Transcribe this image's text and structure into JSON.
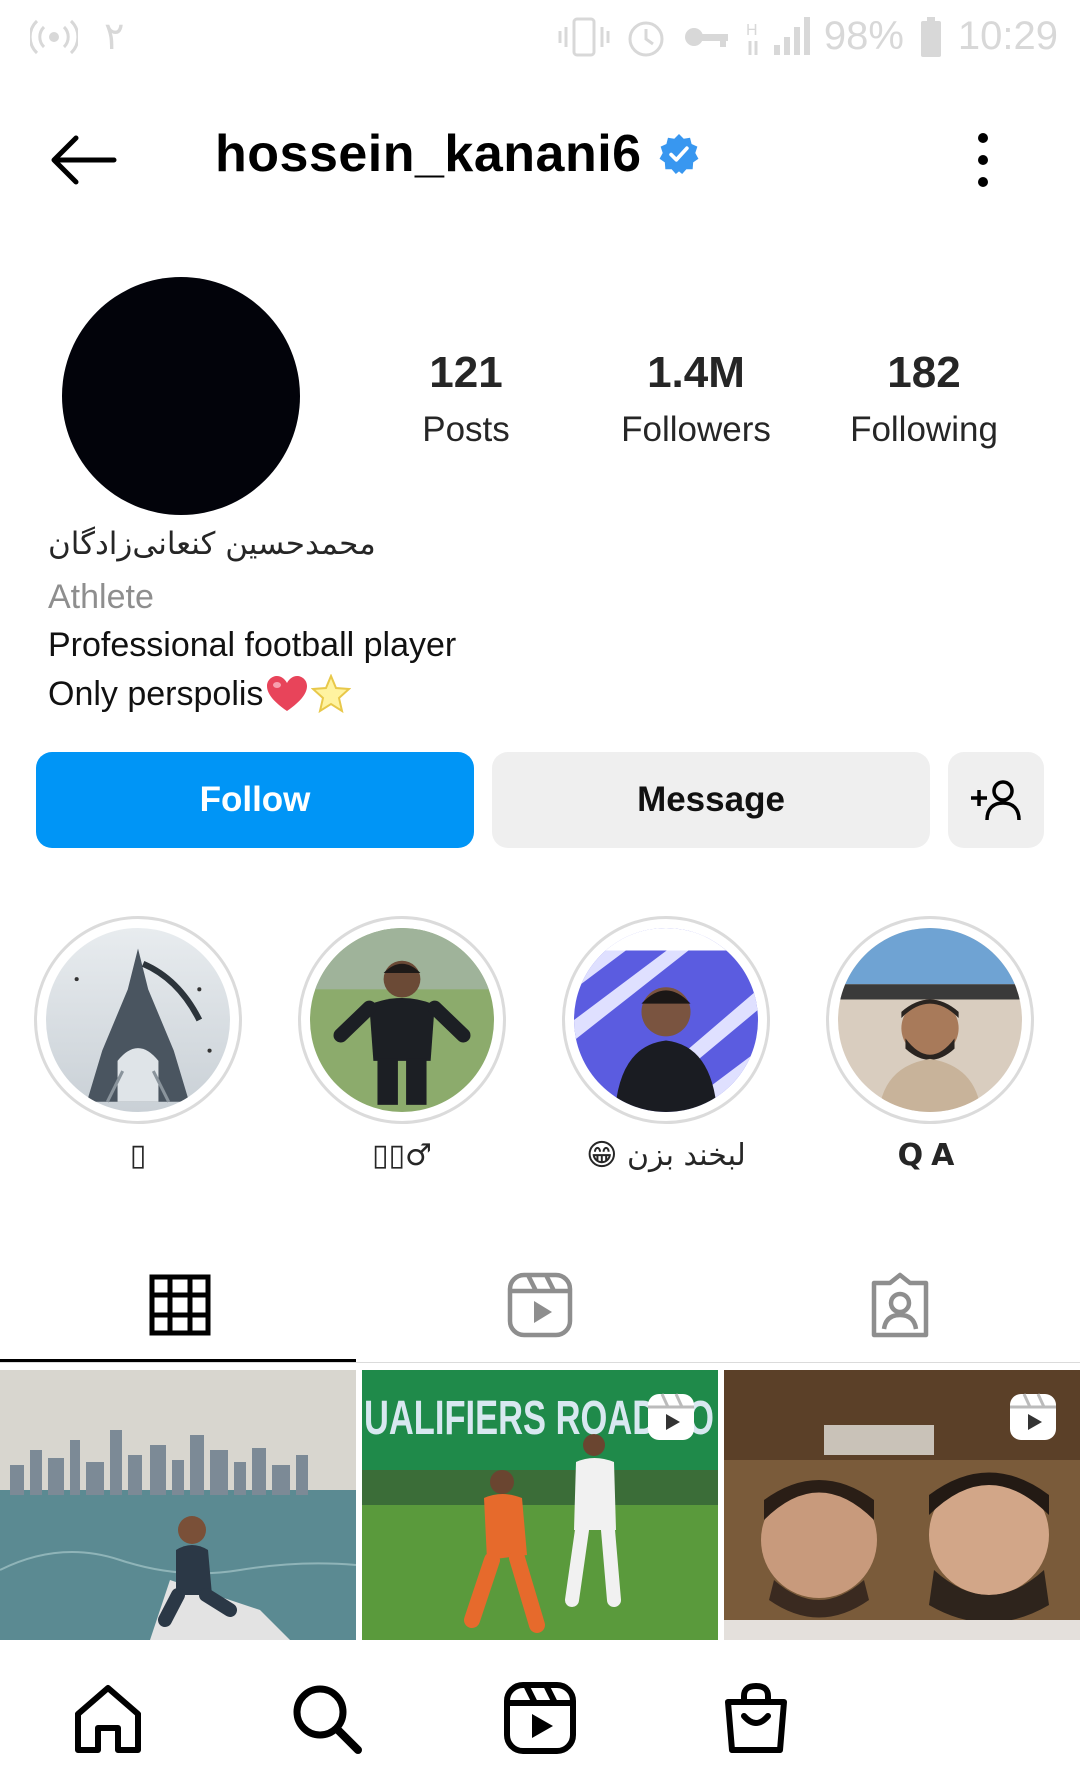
{
  "status_bar": {
    "sim_label": "۲",
    "battery": "98%",
    "time": "10:29"
  },
  "header": {
    "username": "hossein_kanani6",
    "icons": {
      "back": "arrow-left-icon",
      "verified": "verified-badge-icon",
      "menu": "more-vertical-icon"
    }
  },
  "profile": {
    "stats": [
      {
        "value": "121",
        "label": "Posts"
      },
      {
        "value": "1.4M",
        "label": "Followers"
      },
      {
        "value": "182",
        "label": "Following"
      }
    ],
    "full_name": "محمدحسین کنعانی‌زادگان",
    "category": "Athlete",
    "bio_line1": "Professional football player",
    "bio_line2": "Only perspolis"
  },
  "actions": {
    "follow_label": "Follow",
    "message_label": "Message",
    "add_user_icon": "add-user-icon"
  },
  "highlights": [
    {
      "caption": "▯"
    },
    {
      "caption": "▯▯♂"
    },
    {
      "caption": "لبخند بزن 😁"
    },
    {
      "caption": "QA"
    }
  ],
  "tabs": [
    {
      "name": "posts",
      "icon": "grid-icon"
    },
    {
      "name": "reels",
      "icon": "reels-icon"
    },
    {
      "name": "tagged",
      "icon": "tagged-icon"
    }
  ],
  "posts": [
    {
      "type": "photo"
    },
    {
      "type": "reel",
      "overlay_text": "UALIFIERS ROAD TO"
    },
    {
      "type": "reel"
    }
  ],
  "bottom_nav": [
    {
      "name": "home",
      "icon": "home-icon"
    },
    {
      "name": "search",
      "icon": "search-icon"
    },
    {
      "name": "reels",
      "icon": "reels-icon"
    },
    {
      "name": "shop",
      "icon": "shop-bag-icon"
    }
  ],
  "colors": {
    "follow_blue": "#0095f6",
    "secondary_button": "#efefef",
    "verified_blue": "#3897f0",
    "highlight_ring": "#dbdbdb"
  }
}
